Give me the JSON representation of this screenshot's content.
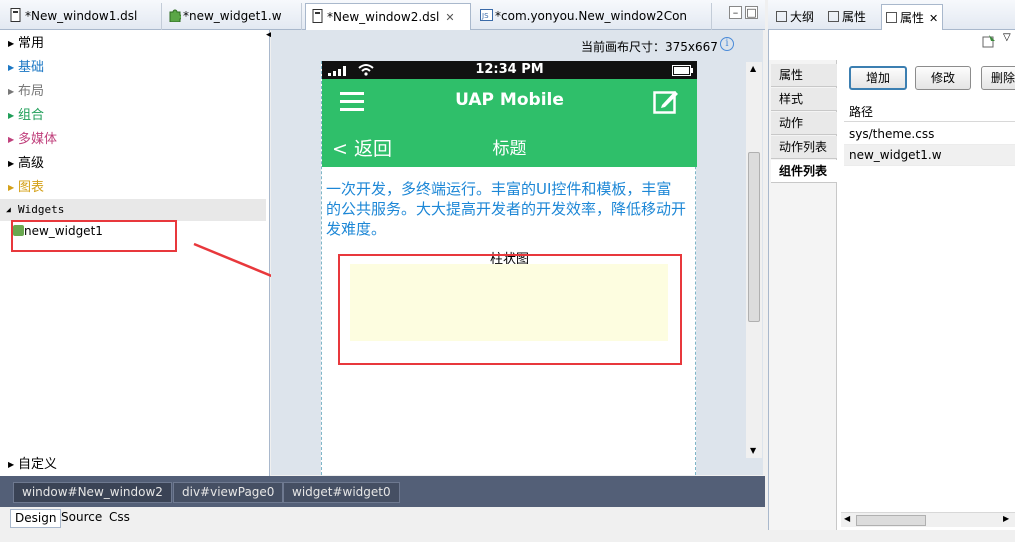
{
  "editor_tabs": [
    {
      "label": "*New_window1.dsl",
      "icon": "dsl-file-icon",
      "closable": false,
      "active": false
    },
    {
      "label": "*new_widget1.w",
      "icon": "widget-file-icon",
      "closable": false,
      "active": false
    },
    {
      "label": "*New_window2.dsl",
      "icon": "dsl-file-icon",
      "closable": true,
      "active": true
    },
    {
      "label": "*com.yonyou.New_window2Con",
      "icon": "js-file-icon",
      "closable": false,
      "active": false
    }
  ],
  "palette": {
    "categories": [
      {
        "label": "常用",
        "color": "#000000"
      },
      {
        "label": "基础",
        "color": "#1b77c4"
      },
      {
        "label": "布局",
        "color": "#777777"
      },
      {
        "label": "组合",
        "color": "#1f9e58"
      },
      {
        "label": "多媒体",
        "color": "#c0407c"
      },
      {
        "label": "高级",
        "color": "#000000"
      },
      {
        "label": "图表",
        "color": "#d4a017"
      }
    ],
    "widgets_header": "Widgets",
    "widget_item": "new_widget1",
    "custom_label": "自定义"
  },
  "canvas": {
    "size_label": "当前画布尺寸：375x667",
    "info_symbol": "i"
  },
  "phone": {
    "time": "12:34 PM",
    "app_title": "UAP Mobile",
    "back_label": "返回",
    "page_title": "标题",
    "intro_text": "一次开发，多终端运行。丰富的UI控件和模板，丰富的公共服务。大大提高开发者的开发效率，降低移动开发难度。",
    "chart_title": "柱状图"
  },
  "breadcrumbs": [
    "window#New_window2",
    "div#viewPage0",
    "widget#widget0"
  ],
  "bottom_tabs": [
    "Design",
    "Source",
    "Css"
  ],
  "right_tabs": [
    {
      "label": "大纲",
      "active": false
    },
    {
      "label": "属性",
      "active": false
    },
    {
      "label": "属性",
      "active": true
    }
  ],
  "vertical_tabs": [
    {
      "label": "属性",
      "selected": false
    },
    {
      "label": "样式",
      "selected": false
    },
    {
      "label": "动作",
      "selected": false
    },
    {
      "label": "动作列表",
      "selected": false
    },
    {
      "label": "组件列表",
      "selected": true
    }
  ],
  "actions": {
    "add": "增加",
    "edit": "修改",
    "delete": "删除"
  },
  "resource_table": {
    "header": "路径",
    "rows": [
      "sys/theme.css",
      "new_widget1.w"
    ]
  },
  "colors": {
    "brand_green": "#2fbf6a",
    "intro_blue": "#1d87d6",
    "annotation_red": "#e8383c",
    "breadcrumb_bg": "#535f77"
  }
}
